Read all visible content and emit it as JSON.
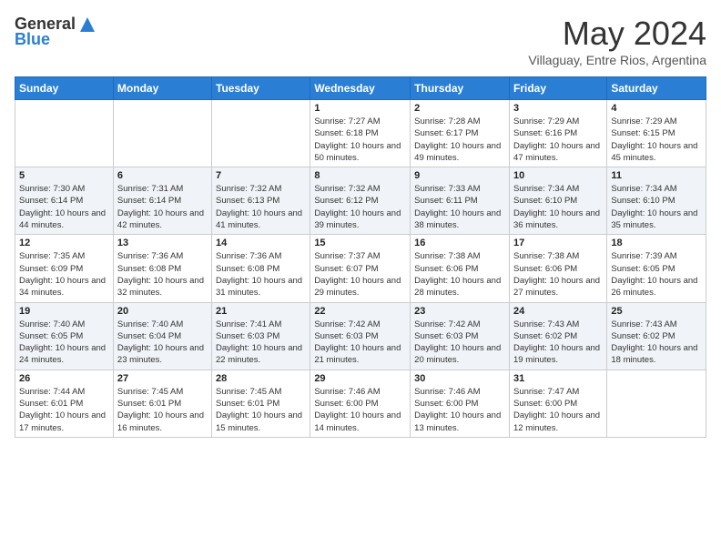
{
  "header": {
    "logo": {
      "line1": "General",
      "line2": "Blue"
    },
    "title": "May 2024",
    "location": "Villaguay, Entre Rios, Argentina"
  },
  "days_of_week": [
    "Sunday",
    "Monday",
    "Tuesday",
    "Wednesday",
    "Thursday",
    "Friday",
    "Saturday"
  ],
  "weeks": [
    [
      {
        "day": "",
        "info": ""
      },
      {
        "day": "",
        "info": ""
      },
      {
        "day": "",
        "info": ""
      },
      {
        "day": "1",
        "info": "Sunrise: 7:27 AM\nSunset: 6:18 PM\nDaylight: 10 hours and 50 minutes."
      },
      {
        "day": "2",
        "info": "Sunrise: 7:28 AM\nSunset: 6:17 PM\nDaylight: 10 hours and 49 minutes."
      },
      {
        "day": "3",
        "info": "Sunrise: 7:29 AM\nSunset: 6:16 PM\nDaylight: 10 hours and 47 minutes."
      },
      {
        "day": "4",
        "info": "Sunrise: 7:29 AM\nSunset: 6:15 PM\nDaylight: 10 hours and 45 minutes."
      }
    ],
    [
      {
        "day": "5",
        "info": "Sunrise: 7:30 AM\nSunset: 6:14 PM\nDaylight: 10 hours and 44 minutes."
      },
      {
        "day": "6",
        "info": "Sunrise: 7:31 AM\nSunset: 6:14 PM\nDaylight: 10 hours and 42 minutes."
      },
      {
        "day": "7",
        "info": "Sunrise: 7:32 AM\nSunset: 6:13 PM\nDaylight: 10 hours and 41 minutes."
      },
      {
        "day": "8",
        "info": "Sunrise: 7:32 AM\nSunset: 6:12 PM\nDaylight: 10 hours and 39 minutes."
      },
      {
        "day": "9",
        "info": "Sunrise: 7:33 AM\nSunset: 6:11 PM\nDaylight: 10 hours and 38 minutes."
      },
      {
        "day": "10",
        "info": "Sunrise: 7:34 AM\nSunset: 6:10 PM\nDaylight: 10 hours and 36 minutes."
      },
      {
        "day": "11",
        "info": "Sunrise: 7:34 AM\nSunset: 6:10 PM\nDaylight: 10 hours and 35 minutes."
      }
    ],
    [
      {
        "day": "12",
        "info": "Sunrise: 7:35 AM\nSunset: 6:09 PM\nDaylight: 10 hours and 34 minutes."
      },
      {
        "day": "13",
        "info": "Sunrise: 7:36 AM\nSunset: 6:08 PM\nDaylight: 10 hours and 32 minutes."
      },
      {
        "day": "14",
        "info": "Sunrise: 7:36 AM\nSunset: 6:08 PM\nDaylight: 10 hours and 31 minutes."
      },
      {
        "day": "15",
        "info": "Sunrise: 7:37 AM\nSunset: 6:07 PM\nDaylight: 10 hours and 29 minutes."
      },
      {
        "day": "16",
        "info": "Sunrise: 7:38 AM\nSunset: 6:06 PM\nDaylight: 10 hours and 28 minutes."
      },
      {
        "day": "17",
        "info": "Sunrise: 7:38 AM\nSunset: 6:06 PM\nDaylight: 10 hours and 27 minutes."
      },
      {
        "day": "18",
        "info": "Sunrise: 7:39 AM\nSunset: 6:05 PM\nDaylight: 10 hours and 26 minutes."
      }
    ],
    [
      {
        "day": "19",
        "info": "Sunrise: 7:40 AM\nSunset: 6:05 PM\nDaylight: 10 hours and 24 minutes."
      },
      {
        "day": "20",
        "info": "Sunrise: 7:40 AM\nSunset: 6:04 PM\nDaylight: 10 hours and 23 minutes."
      },
      {
        "day": "21",
        "info": "Sunrise: 7:41 AM\nSunset: 6:03 PM\nDaylight: 10 hours and 22 minutes."
      },
      {
        "day": "22",
        "info": "Sunrise: 7:42 AM\nSunset: 6:03 PM\nDaylight: 10 hours and 21 minutes."
      },
      {
        "day": "23",
        "info": "Sunrise: 7:42 AM\nSunset: 6:03 PM\nDaylight: 10 hours and 20 minutes."
      },
      {
        "day": "24",
        "info": "Sunrise: 7:43 AM\nSunset: 6:02 PM\nDaylight: 10 hours and 19 minutes."
      },
      {
        "day": "25",
        "info": "Sunrise: 7:43 AM\nSunset: 6:02 PM\nDaylight: 10 hours and 18 minutes."
      }
    ],
    [
      {
        "day": "26",
        "info": "Sunrise: 7:44 AM\nSunset: 6:01 PM\nDaylight: 10 hours and 17 minutes."
      },
      {
        "day": "27",
        "info": "Sunrise: 7:45 AM\nSunset: 6:01 PM\nDaylight: 10 hours and 16 minutes."
      },
      {
        "day": "28",
        "info": "Sunrise: 7:45 AM\nSunset: 6:01 PM\nDaylight: 10 hours and 15 minutes."
      },
      {
        "day": "29",
        "info": "Sunrise: 7:46 AM\nSunset: 6:00 PM\nDaylight: 10 hours and 14 minutes."
      },
      {
        "day": "30",
        "info": "Sunrise: 7:46 AM\nSunset: 6:00 PM\nDaylight: 10 hours and 13 minutes."
      },
      {
        "day": "31",
        "info": "Sunrise: 7:47 AM\nSunset: 6:00 PM\nDaylight: 10 hours and 12 minutes."
      },
      {
        "day": "",
        "info": ""
      }
    ]
  ]
}
